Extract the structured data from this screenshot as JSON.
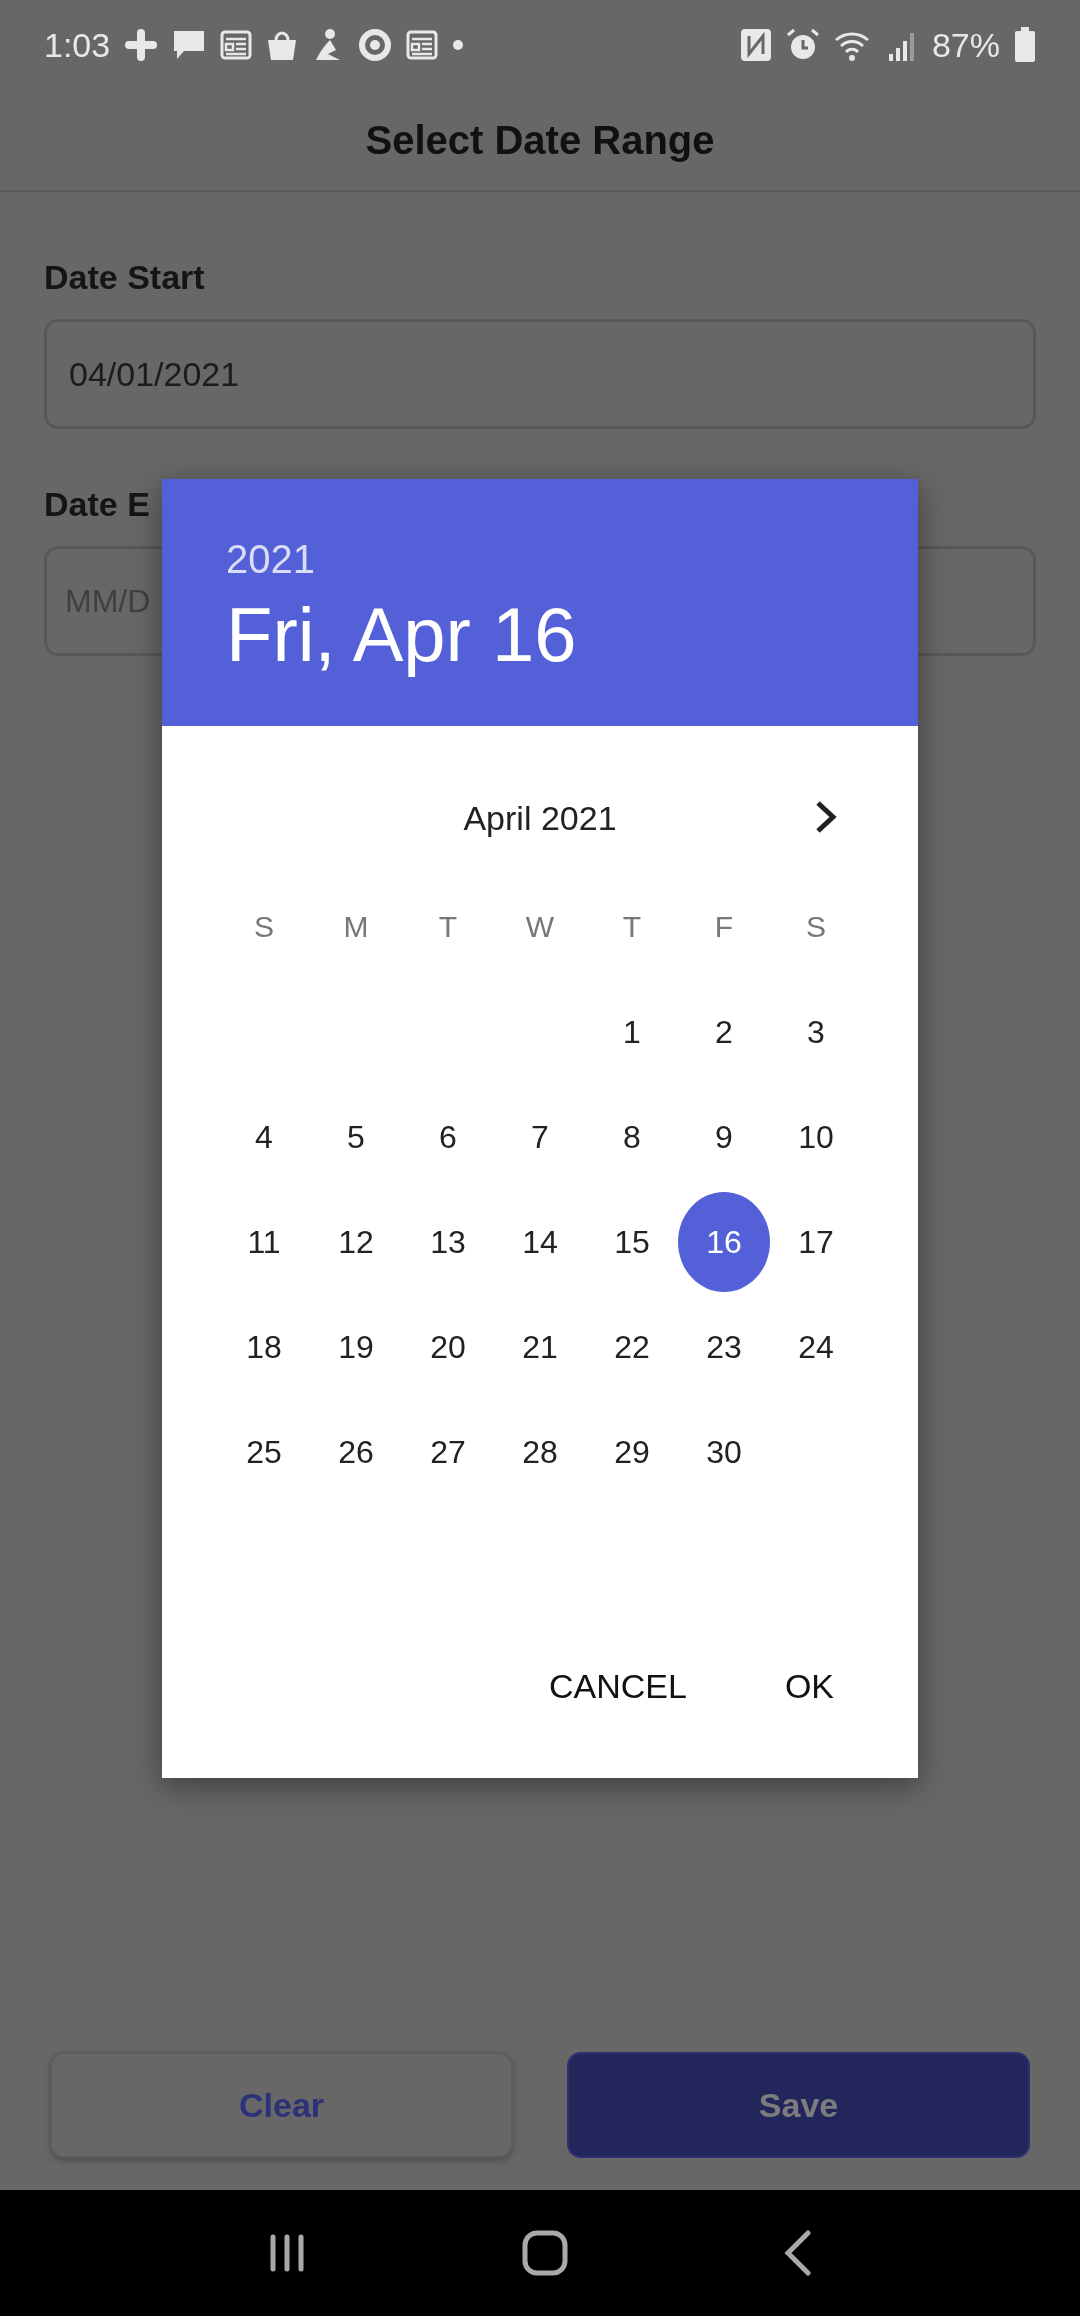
{
  "status_bar": {
    "time": "1:03",
    "battery": "87%"
  },
  "title": "Select Date Range",
  "fields": [
    {
      "label": "Date Start",
      "value": "04/01/2021"
    },
    {
      "label": "Date E",
      "placeholder": "MM/D"
    }
  ],
  "buttons": [
    {
      "label": "Clear",
      "kind": "outline"
    },
    {
      "label": "Save",
      "kind": "filled"
    }
  ],
  "dialog": {
    "year": "2021",
    "date": "Fri, Apr 16",
    "month": "April 2021",
    "weekdays": [
      "S",
      "M",
      "T",
      "W",
      "T",
      "F",
      "S"
    ],
    "weeks": [
      [
        {
          "day": "1",
          "selected": false
        },
        {
          "day": "2",
          "selected": false
        },
        {
          "day": "3",
          "selected": false
        }
      ],
      [
        {
          "day": "4",
          "selected": false
        },
        {
          "day": "5",
          "selected": false
        },
        {
          "day": "6",
          "selected": false
        },
        {
          "day": "7",
          "selected": false
        },
        {
          "day": "8",
          "selected": false
        },
        {
          "day": "9",
          "selected": false
        },
        {
          "day": "10",
          "selected": false
        }
      ],
      [
        {
          "day": "11",
          "selected": false
        },
        {
          "day": "12",
          "selected": false
        },
        {
          "day": "13",
          "selected": false
        },
        {
          "day": "14",
          "selected": false
        },
        {
          "day": "15",
          "selected": false
        },
        {
          "day": "16",
          "selected": true
        },
        {
          "day": "17",
          "selected": false
        }
      ],
      [
        {
          "day": "18",
          "selected": false
        },
        {
          "day": "19",
          "selected": false
        },
        {
          "day": "20",
          "selected": false
        },
        {
          "day": "21",
          "selected": false
        },
        {
          "day": "22",
          "selected": false
        },
        {
          "day": "23",
          "selected": false
        },
        {
          "day": "24",
          "selected": false
        }
      ],
      [
        {
          "day": "25",
          "selected": false
        },
        {
          "day": "26",
          "selected": false
        },
        {
          "day": "27",
          "selected": false
        },
        {
          "day": "28",
          "selected": false
        },
        {
          "day": "29",
          "selected": false
        },
        {
          "day": "30",
          "selected": false
        }
      ]
    ],
    "actions": [
      "CANCEL",
      "OK"
    ]
  }
}
